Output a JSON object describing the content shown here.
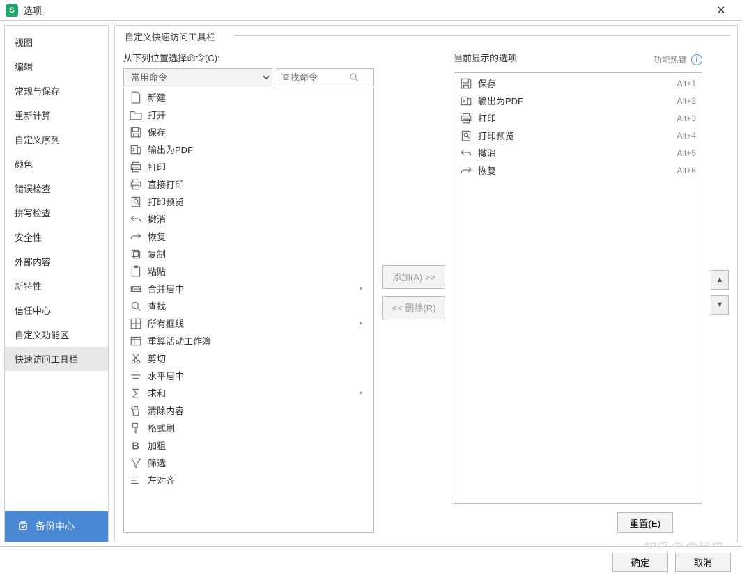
{
  "titlebar": {
    "title": "选项"
  },
  "sidebar": {
    "items": [
      {
        "label": "视图"
      },
      {
        "label": "编辑"
      },
      {
        "label": "常规与保存"
      },
      {
        "label": "重新计算"
      },
      {
        "label": "自定义序列"
      },
      {
        "label": "颜色"
      },
      {
        "label": "错误检查"
      },
      {
        "label": "拼写检查"
      },
      {
        "label": "安全性"
      },
      {
        "label": "外部内容"
      },
      {
        "label": "新特性"
      },
      {
        "label": "信任中心"
      },
      {
        "label": "自定义功能区"
      },
      {
        "label": "快速访问工具栏"
      }
    ],
    "selected_index": 13,
    "backup_label": "备份中心"
  },
  "content": {
    "fieldset_title": "自定义快速访问工具栏",
    "source_label": "从下列位置选择命令(C):",
    "dropdown_value": "常用命令",
    "search_placeholder": "查找命令",
    "current_label": "当前显示的选项",
    "hotkey_label": "功能热键",
    "add_btn": "添加(A) >>",
    "remove_btn": "<< 删除(R)",
    "reset_btn": "重置(E)",
    "source_list": [
      {
        "icon": "new",
        "label": "新建"
      },
      {
        "icon": "open",
        "label": "打开"
      },
      {
        "icon": "save",
        "label": "保存"
      },
      {
        "icon": "pdf",
        "label": "输出为PDF"
      },
      {
        "icon": "print",
        "label": "打印"
      },
      {
        "icon": "printd",
        "label": "直接打印"
      },
      {
        "icon": "preview",
        "label": "打印预览"
      },
      {
        "icon": "undo",
        "label": "撤消"
      },
      {
        "icon": "redo",
        "label": "恢复"
      },
      {
        "icon": "copy",
        "label": "复制"
      },
      {
        "icon": "paste",
        "label": "粘贴"
      },
      {
        "icon": "merge",
        "label": "合并居中",
        "sub": true
      },
      {
        "icon": "find",
        "label": "查找"
      },
      {
        "icon": "border",
        "label": "所有框线",
        "sub": true
      },
      {
        "icon": "recalc",
        "label": "重算活动工作簿"
      },
      {
        "icon": "cut",
        "label": "剪切"
      },
      {
        "icon": "hcenter",
        "label": "水平居中"
      },
      {
        "icon": "sum",
        "label": "求和",
        "sub": true
      },
      {
        "icon": "clear",
        "label": "清除内容"
      },
      {
        "icon": "format",
        "label": "格式刷"
      },
      {
        "icon": "bold",
        "label": "加粗"
      },
      {
        "icon": "filter",
        "label": "筛选"
      },
      {
        "icon": "left",
        "label": "左对齐"
      }
    ],
    "current_list": [
      {
        "icon": "save",
        "label": "保存",
        "key": "Alt+1"
      },
      {
        "icon": "pdf",
        "label": "输出为PDF",
        "key": "Alt+2"
      },
      {
        "icon": "print",
        "label": "打印",
        "key": "Alt+3"
      },
      {
        "icon": "preview",
        "label": "打印预览",
        "key": "Alt+4"
      },
      {
        "icon": "undo",
        "label": "撤消",
        "key": "Alt+5"
      },
      {
        "icon": "redo",
        "label": "恢复",
        "key": "Alt+6"
      }
    ]
  },
  "footer": {
    "ok": "确定",
    "cancel": "取消"
  },
  "watermark": "知乎 @像最初"
}
